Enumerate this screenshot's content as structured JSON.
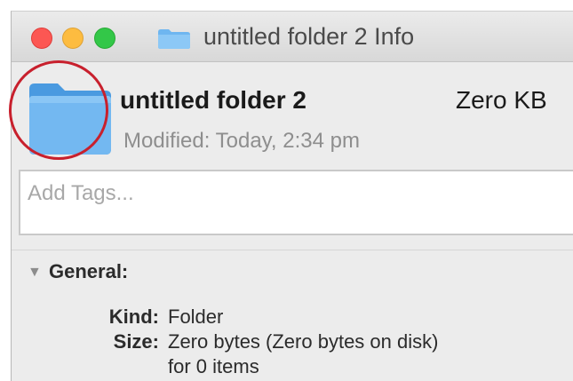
{
  "window": {
    "title": "untitled folder 2 Info",
    "folder_icon": "folder-icon",
    "traffic_lights": {
      "close_color": "#fc5753",
      "minimize_color": "#fdbc40",
      "zoom_color": "#33c748"
    }
  },
  "header": {
    "name": "untitled folder 2",
    "size": "Zero KB",
    "modified": "Modified: Today, 2:34 pm",
    "annotation_color": "#c8202d"
  },
  "tags": {
    "placeholder": "Add Tags..."
  },
  "general": {
    "title": "General:",
    "toggle_icon": "disclosure-triangle-down-icon",
    "kind_label": "Kind:",
    "kind_value": "Folder",
    "size_label": "Size:",
    "size_value_line1": "Zero bytes (Zero bytes on disk)",
    "size_value_line2": "for 0 items"
  }
}
